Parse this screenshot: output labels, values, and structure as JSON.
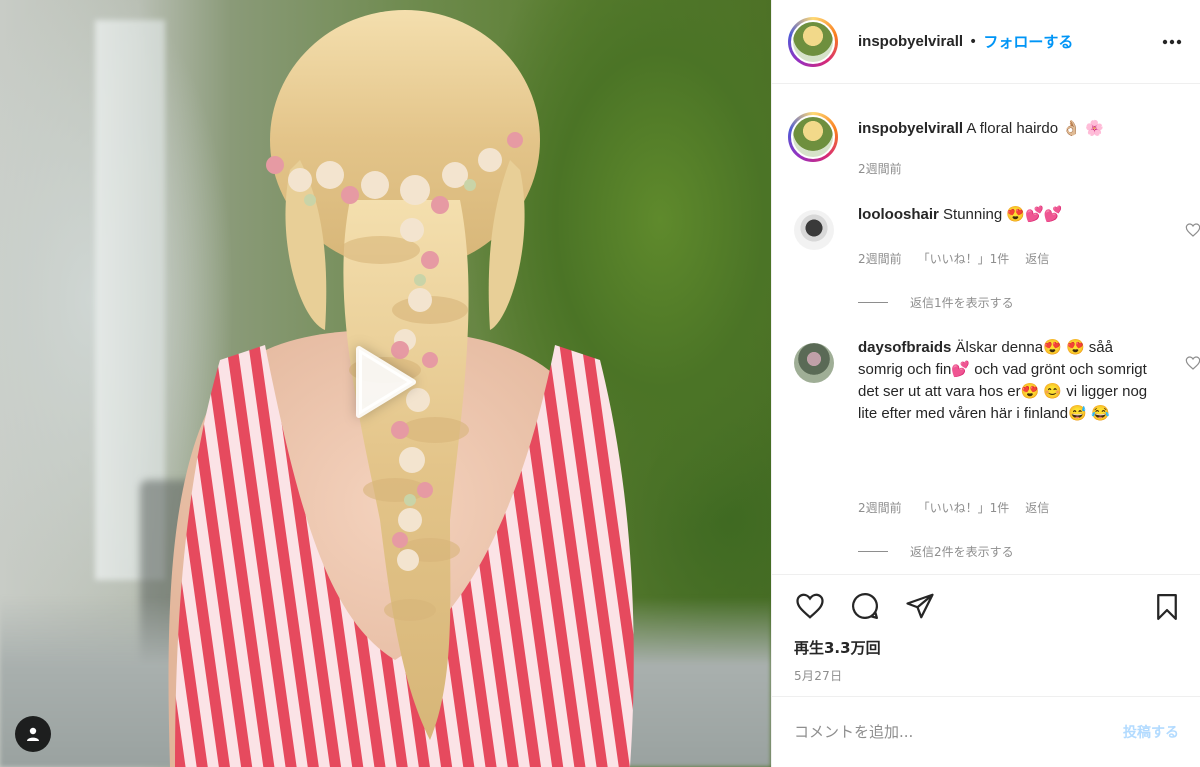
{
  "post": {
    "username": "inspobyelvirall",
    "separator": "•",
    "follow_label": "フォローする",
    "more_icon": "more-horizontal-icon"
  },
  "caption": {
    "username": "inspobyelvirall",
    "text": "A floral hairdo 👌🏼 🌸",
    "time": "2週間前"
  },
  "comments": [
    {
      "username": "loolooshair",
      "text": "Stunning 😍💕💕",
      "time": "2週間前",
      "likes": "「いいね！」1件",
      "reply_label": "返信",
      "replies_toggle": "返信1件を表示する"
    },
    {
      "username": "daysofbraids",
      "text": "Älskar denna😍 😍 såå somrig och fin💕  och vad grönt och somrigt det ser ut att vara hos er😍 😊  vi ligger nog lite efter med våren här i finland😅 😂",
      "time": "2週間前",
      "likes": "「いいね！」1件",
      "reply_label": "返信",
      "replies_toggle": "返信2件を表示する"
    }
  ],
  "stats": {
    "views": "再生3.3万回",
    "date": "5月27日"
  },
  "comment_box": {
    "placeholder": "コメントを追加...",
    "post_label": "投稿する"
  },
  "colors": {
    "accent": "#0095f6",
    "post_disabled": "#b3dbff",
    "muted": "#8e8e8e",
    "text": "#262626"
  }
}
